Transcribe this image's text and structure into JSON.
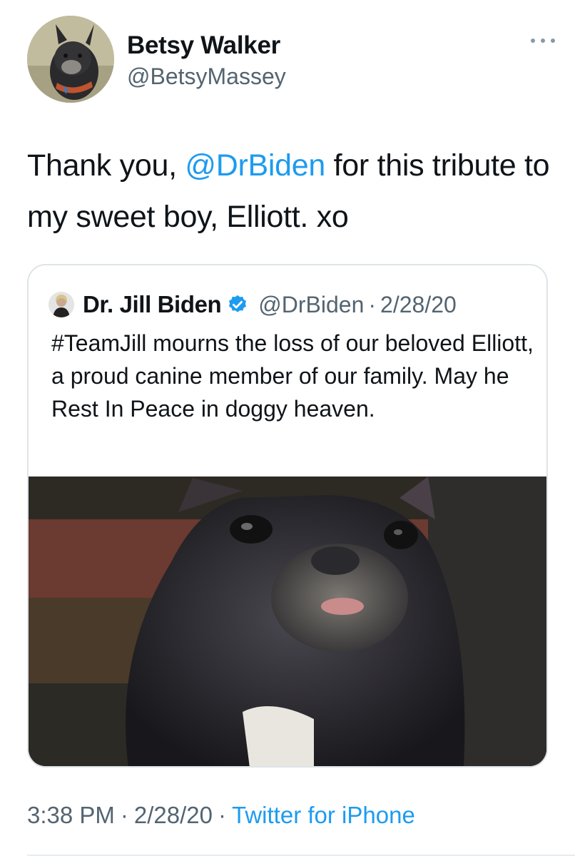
{
  "author": {
    "display_name": "Betsy Walker",
    "handle": "@BetsyMassey"
  },
  "tweet": {
    "text_before": "Thank you, ",
    "mention": "@DrBiden",
    "text_after": " for this tribute to my sweet boy, Elliott. xo"
  },
  "quoted_tweet": {
    "display_name": "Dr. Jill Biden",
    "verified": true,
    "handle": "@DrBiden",
    "separator": "·",
    "date": "2/28/20",
    "text": "#TeamJill mourns the loss of our beloved Elliott, a proud canine member of our family. May he Rest In Peace in doggy heaven."
  },
  "footer": {
    "time": "3:38 PM",
    "separator": "·",
    "date": "2/28/20",
    "source": "Twitter for iPhone"
  },
  "icons": {
    "more": "more-icon",
    "verified": "verified-badge-icon"
  },
  "colors": {
    "link": "#1d9bf0",
    "secondary_text": "#536471",
    "border": "#dfe4e8"
  }
}
